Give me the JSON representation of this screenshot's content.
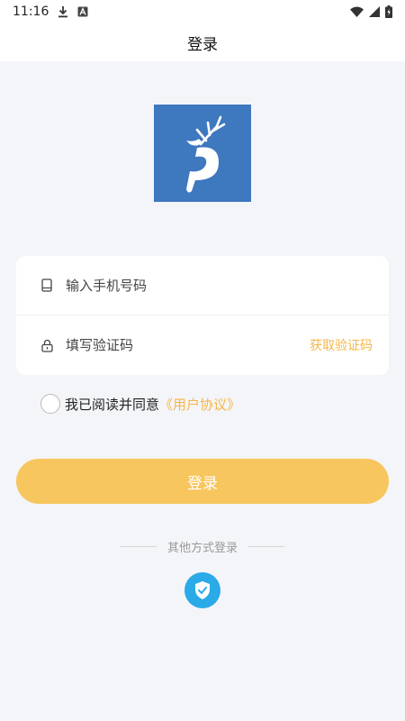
{
  "status_bar": {
    "time": "11:16",
    "icons": [
      "download-icon",
      "text-a-icon",
      "wifi-icon",
      "signal-icon",
      "battery-icon"
    ]
  },
  "nav": {
    "title": "登录"
  },
  "logo": {
    "name": "deer-logo",
    "color": "#3e78bf"
  },
  "form": {
    "phone": {
      "icon": "phone-icon",
      "placeholder": "输入手机号码",
      "value": ""
    },
    "code": {
      "icon": "lock-icon",
      "placeholder": "填写验证码",
      "value": "",
      "get_code_label": "获取验证码"
    }
  },
  "agreement": {
    "checked": false,
    "text": "我已阅读并同意",
    "link": "《用户协议》"
  },
  "login_button": {
    "label": "登录",
    "color": "#f8c65e"
  },
  "other_login": {
    "label": "其他方式登录",
    "icon": "shield-check-icon",
    "icon_color": "#2aaae6"
  },
  "colors": {
    "accent": "#f4b64a",
    "background": "#f4f5f9"
  }
}
